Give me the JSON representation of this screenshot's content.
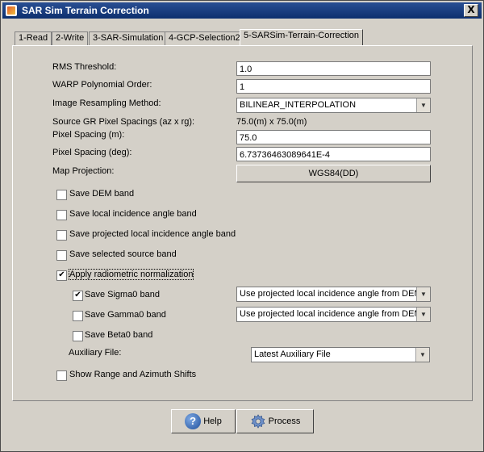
{
  "window": {
    "title": "SAR Sim Terrain Correction",
    "close_label": "X"
  },
  "tabs": [
    {
      "label": "1-Read"
    },
    {
      "label": "2-Write"
    },
    {
      "label": "3-SAR-Simulation"
    },
    {
      "label": "4-GCP-Selection2"
    },
    {
      "label": "5-SARSim-Terrain-Correction"
    }
  ],
  "form": {
    "rms_threshold": {
      "label": "RMS Threshold:",
      "value": "1.0"
    },
    "warp_order": {
      "label": "WARP Polynomial Order:",
      "value": "1"
    },
    "resampling": {
      "label": "Image Resampling Method:",
      "value": "BILINEAR_INTERPOLATION"
    },
    "source_spacing": {
      "label": "Source GR Pixel Spacings (az x rg):",
      "value": "75.0(m) x 75.0(m)"
    },
    "pixel_spacing_m": {
      "label": "Pixel Spacing (m):",
      "value": "75.0"
    },
    "pixel_spacing_deg": {
      "label": "Pixel Spacing (deg):",
      "value": "6.73736463089641E-4"
    },
    "map_projection": {
      "label": "Map Projection:",
      "value": "WGS84(DD)"
    }
  },
  "checks": {
    "save_dem": {
      "label": "Save DEM band",
      "checked": false
    },
    "save_lia": {
      "label": "Save local incidence angle band",
      "checked": false
    },
    "save_plia": {
      "label": "Save projected local incidence angle band",
      "checked": false
    },
    "save_src": {
      "label": "Save selected source band",
      "checked": false
    },
    "apply_norm": {
      "label": "Apply radiometric normalization",
      "checked": true
    },
    "sigma0": {
      "label": "Save Sigma0 band",
      "checked": true,
      "option": "Use projected local incidence angle from DEM"
    },
    "gamma0": {
      "label": "Save Gamma0 band",
      "checked": false,
      "option": "Use projected local incidence angle from DEM"
    },
    "beta0": {
      "label": "Save Beta0 band",
      "checked": false
    },
    "range_az": {
      "label": "Show Range and Azimuth Shifts",
      "checked": false
    }
  },
  "auxiliary": {
    "label": "Auxiliary File:",
    "value": "Latest Auxiliary File"
  },
  "buttons": {
    "help": "Help",
    "process": "Process"
  },
  "icons": {
    "help": "help-icon",
    "process": "gear-icon",
    "combo": "chevron-down-icon"
  }
}
